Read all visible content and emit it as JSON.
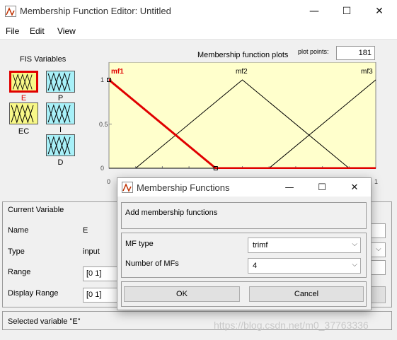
{
  "window": {
    "title": "Membership Function Editor: Untitled",
    "minimize": "—",
    "maximize": "☐",
    "close": "✕"
  },
  "menu": {
    "items": [
      "File",
      "Edit",
      "View"
    ]
  },
  "fis": {
    "title": "FIS Variables",
    "variables": [
      {
        "name": "E",
        "kind": "input",
        "selected": true
      },
      {
        "name": "P",
        "kind": "output",
        "selected": false
      },
      {
        "name": "EC",
        "kind": "input",
        "selected": false
      },
      {
        "name": "I",
        "kind": "output",
        "selected": false
      },
      {
        "name": "D",
        "kind": "output",
        "selected": false
      }
    ]
  },
  "plot": {
    "title": "Membership function plots",
    "points_label": "plot points:",
    "points_value": "181",
    "mf_labels": [
      "mf1",
      "mf2",
      "mf3"
    ],
    "y_ticks": [
      "0",
      "0.5",
      "1"
    ],
    "x_ticks": [
      "0",
      "1"
    ],
    "colors": {
      "background": "#ffffcc",
      "selected": "#e00000",
      "normal": "#000000"
    }
  },
  "chart_data": {
    "type": "line",
    "xlim": [
      0,
      1
    ],
    "ylim": [
      0,
      1
    ],
    "series": [
      {
        "name": "mf1",
        "x": [
          -0.5,
          0,
          0.4,
          1
        ],
        "y": [
          1,
          1,
          0,
          0
        ]
      },
      {
        "name": "mf2",
        "x": [
          0,
          0.1,
          0.5,
          0.9,
          1
        ],
        "y": [
          0,
          0,
          1,
          0,
          0
        ]
      },
      {
        "name": "mf3",
        "x": [
          0,
          0.6,
          1,
          1.4
        ],
        "y": [
          0,
          0,
          1,
          1
        ]
      }
    ]
  },
  "current_variable": {
    "title": "Current Variable",
    "name_label": "Name",
    "name_value": "E",
    "type_label": "Type",
    "type_value": "input",
    "range_label": "Range",
    "range_value": "[0 1]",
    "display_range_label": "Display Range",
    "display_range_value": "[0 1]"
  },
  "status": {
    "text": "Selected variable \"E\""
  },
  "dialog": {
    "title": "Membership Functions",
    "minimize": "—",
    "maximize": "☐",
    "close": "✕",
    "header": "Add membership functions",
    "mf_type_label": "MF type",
    "mf_type_value": "trimf",
    "num_mfs_label": "Number of MFs",
    "num_mfs_value": "4",
    "ok_label": "OK",
    "cancel_label": "Cancel"
  },
  "watermark": "https://blog.csdn.net/m0_37763336"
}
